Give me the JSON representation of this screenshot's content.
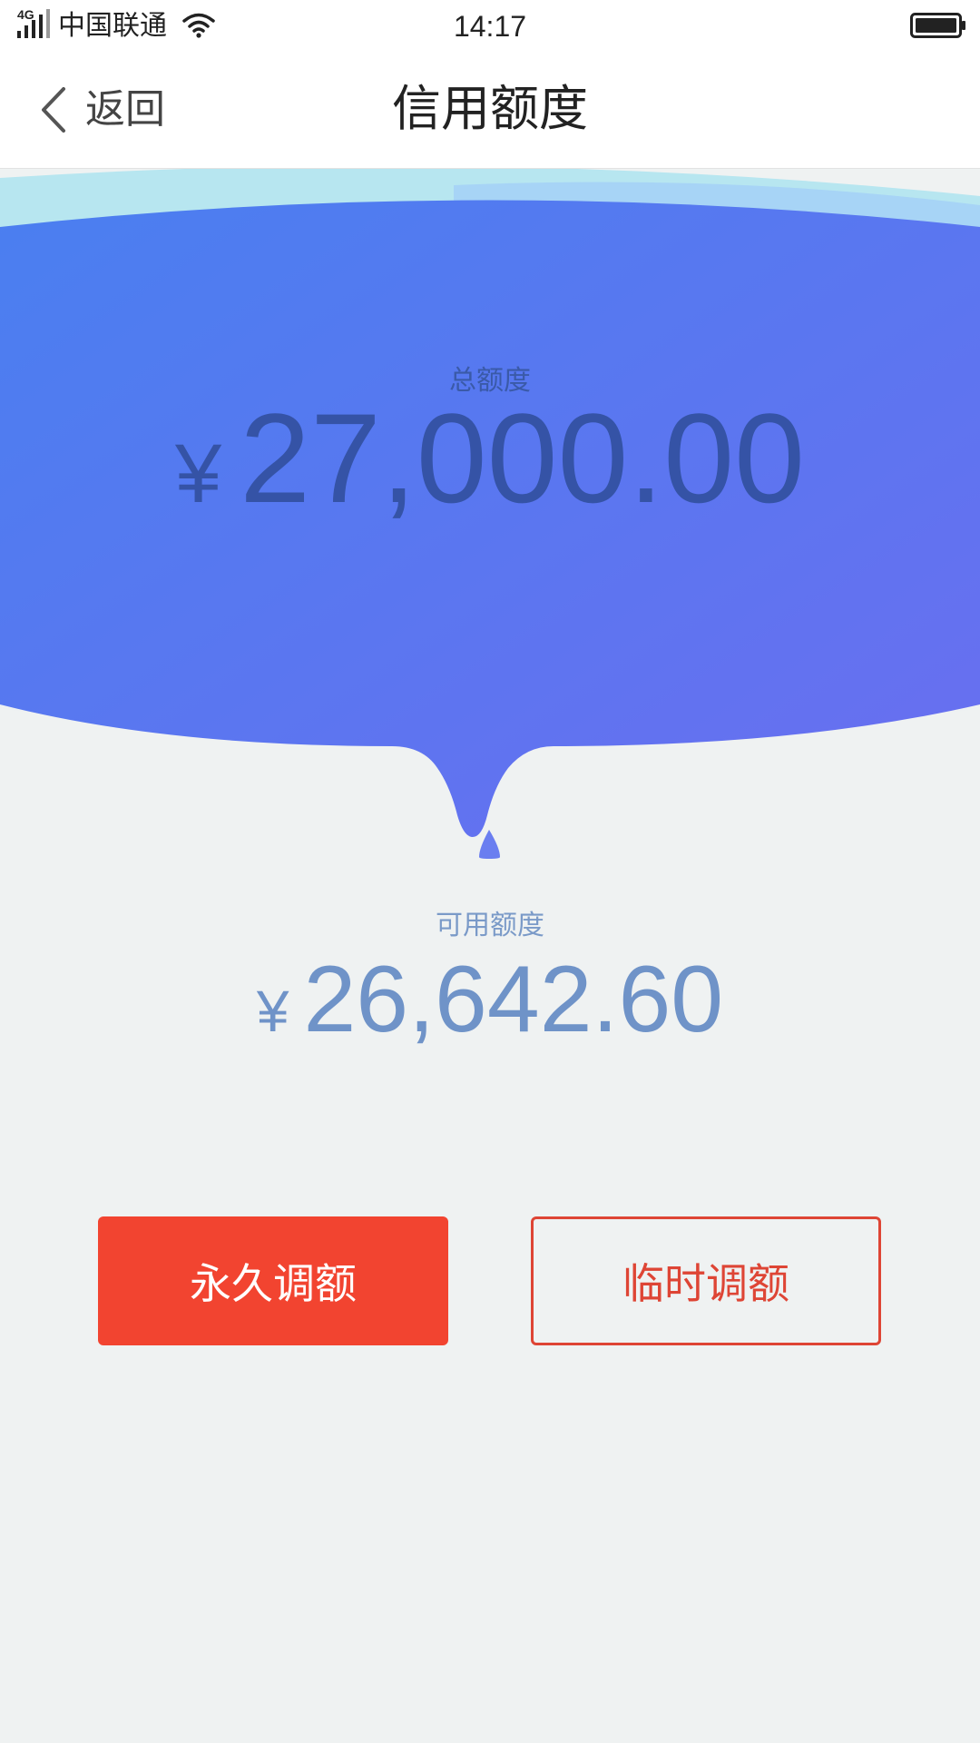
{
  "status_bar": {
    "network": "4G",
    "carrier": "中国联通",
    "time": "14:17"
  },
  "nav": {
    "back_label": "返回",
    "title": "信用额度"
  },
  "total": {
    "label": "总额度",
    "currency": "¥",
    "amount": "27,000.00"
  },
  "available": {
    "label": "可用额度",
    "currency": "¥",
    "amount": "26,642.60"
  },
  "actions": {
    "permanent_label": "永久调额",
    "temporary_label": "临时调额"
  },
  "colors": {
    "primary_red": "#f24430",
    "outline_red": "#de4535",
    "hero_blue_start": "#4a7ff0",
    "hero_blue_end": "#6a6ef0",
    "page_bg": "#eff2f2"
  },
  "icons": {
    "signal": "signal-bars-icon",
    "wifi": "wifi-icon",
    "battery": "battery-icon",
    "back": "chevron-left-icon",
    "droplet": "droplet-icon"
  }
}
